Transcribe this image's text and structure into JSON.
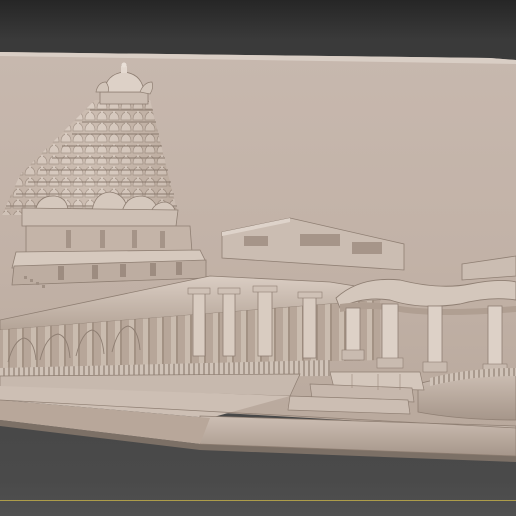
{
  "viewport": {
    "background": "#454545",
    "model_color": "#c8b8ac",
    "model_shadow": "#8f8077",
    "model_highlight": "#e2d6cc",
    "ground_line_color": "#b9a64a"
  },
  "model": {
    "subject": "temple-relief-3d-model"
  }
}
